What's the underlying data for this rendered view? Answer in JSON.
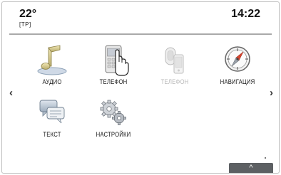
{
  "status": {
    "temperature": "22°",
    "source_tag": "[TP]",
    "time": "14:22"
  },
  "nav": {
    "prev": "‹",
    "next": "›"
  },
  "apps": [
    {
      "label": "АУДИО",
      "icon": "music-note-icon",
      "enabled": true
    },
    {
      "label": "ТЕЛЕФОН",
      "icon": "phone-icon",
      "enabled": true,
      "pressed": true
    },
    {
      "label": "ТЕЛЕФОН",
      "icon": "projection-phone-icon",
      "enabled": false
    },
    {
      "label": "НАВИГАЦИЯ",
      "icon": "compass-icon",
      "enabled": true
    },
    {
      "label": "ТЕКСТ",
      "icon": "chat-bubbles-icon",
      "enabled": true
    },
    {
      "label": "НАСТРОЙКИ",
      "icon": "gears-icon",
      "enabled": true
    }
  ],
  "footer": {
    "up_label": "^"
  }
}
